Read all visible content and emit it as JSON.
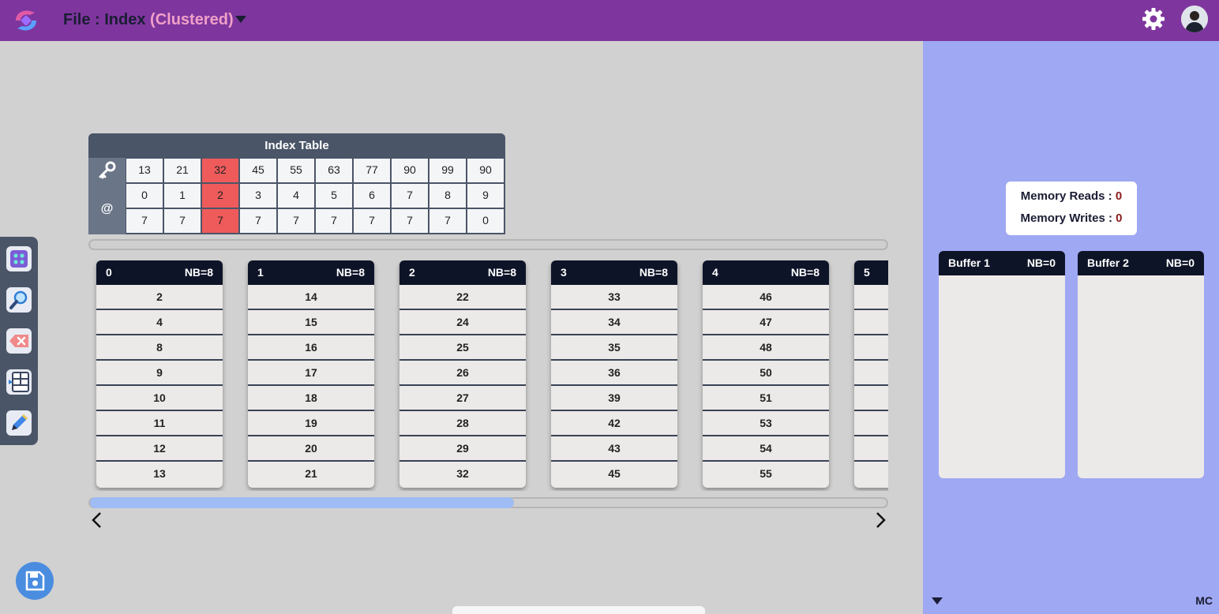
{
  "header": {
    "title_prefix": "File : Index",
    "title_accent": "(Clustered)"
  },
  "index_table": {
    "title": "Index Table",
    "at_label": "@",
    "keys": [
      "13",
      "21",
      "32",
      "45",
      "55",
      "63",
      "77",
      "90",
      "99",
      "90"
    ],
    "blocks": [
      "0",
      "1",
      "2",
      "3",
      "4",
      "5",
      "6",
      "7",
      "8",
      "9"
    ],
    "positions": [
      "7",
      "7",
      "7",
      "7",
      "7",
      "7",
      "7",
      "7",
      "7",
      "0"
    ],
    "highlight_index": 2,
    "highlight_color": "#ef5b5b"
  },
  "blocks": [
    {
      "id": "0",
      "nb": "NB=8",
      "records": [
        "2",
        "4",
        "8",
        "9",
        "10",
        "11",
        "12",
        "13"
      ]
    },
    {
      "id": "1",
      "nb": "NB=8",
      "records": [
        "14",
        "15",
        "16",
        "17",
        "18",
        "19",
        "20",
        "21"
      ]
    },
    {
      "id": "2",
      "nb": "NB=8",
      "records": [
        "22",
        "24",
        "25",
        "26",
        "27",
        "28",
        "29",
        "32"
      ]
    },
    {
      "id": "3",
      "nb": "NB=8",
      "records": [
        "33",
        "34",
        "35",
        "36",
        "39",
        "42",
        "43",
        "45"
      ]
    },
    {
      "id": "4",
      "nb": "NB=8",
      "records": [
        "46",
        "47",
        "48",
        "50",
        "51",
        "53",
        "54",
        "55"
      ]
    },
    {
      "id": "5",
      "nb": "",
      "records": [
        "",
        "",
        "",
        "",
        "",
        "",
        "",
        ""
      ]
    }
  ],
  "block_scroll": {
    "fraction_visible": 0.53
  },
  "memory": {
    "reads_label": "Memory Reads :",
    "reads_value": "0",
    "writes_label": "Memory Writes :",
    "writes_value": "0"
  },
  "buffers": [
    {
      "name": "Buffer 1",
      "nb": "NB=0"
    },
    {
      "name": "Buffer 2",
      "nb": "NB=0"
    }
  ],
  "footer": {
    "mc_label": "MC"
  },
  "colors": {
    "header": "#7e369e",
    "panel": "#9fa8f2",
    "block_head": "#0e1428",
    "accent_title": "#f0a0c8"
  },
  "icons": [
    "app-logo-icon",
    "chevron-down-icon",
    "gear-icon",
    "avatar",
    "grid-icon",
    "search-icon",
    "delete-icon",
    "table-icon",
    "pencil-icon",
    "save-icon",
    "chevron-left-icon",
    "chevron-right-icon"
  ]
}
